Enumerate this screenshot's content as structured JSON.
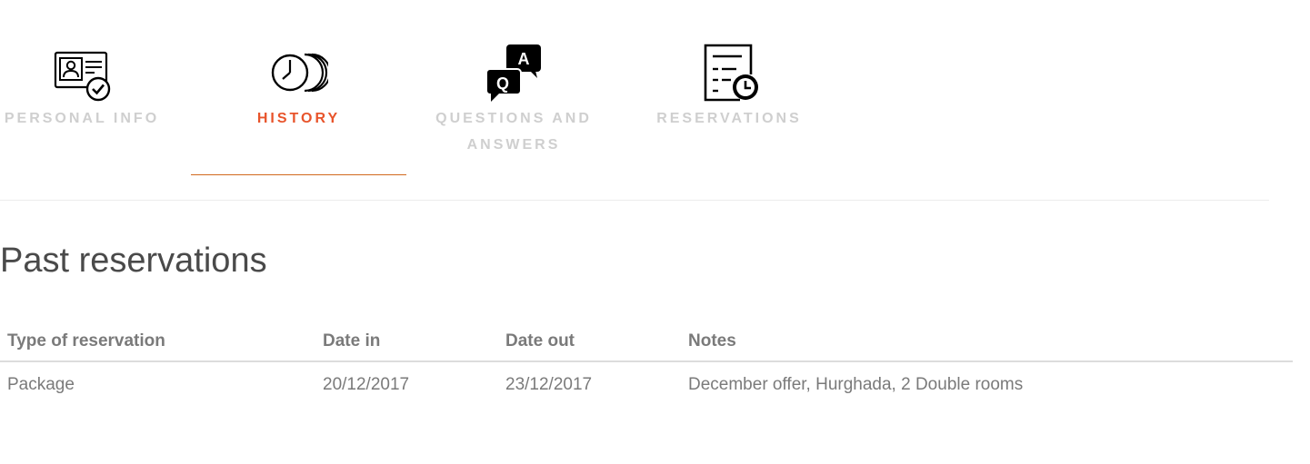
{
  "tabs": [
    {
      "id": "personal",
      "label": "PERSONAL INFO",
      "icon": "id-card-check-icon",
      "active": false
    },
    {
      "id": "history",
      "label": "HISTORY",
      "icon": "history-clock-icon",
      "active": true
    },
    {
      "id": "qa",
      "label": "QUESTIONS AND ANSWERS",
      "icon": "qa-bubbles-icon",
      "active": false
    },
    {
      "id": "reservations",
      "label": "RESERVATIONS",
      "icon": "document-clock-icon",
      "active": false
    }
  ],
  "colors": {
    "active_tab": "#e8542b",
    "active_underline": "#d2691e",
    "inactive_tab": "#cfcfcf",
    "text": "#7a7a7a",
    "heading": "#4a4a4a"
  },
  "section": {
    "title": "Past reservations"
  },
  "table": {
    "headers": {
      "type": "Type of reservation",
      "date_in": "Date in",
      "date_out": "Date out",
      "notes": "Notes"
    },
    "rows": [
      {
        "type": "Package",
        "date_in": "20/12/2017",
        "date_out": "23/12/2017",
        "notes": "December offer, Hurghada, 2 Double rooms"
      }
    ]
  }
}
